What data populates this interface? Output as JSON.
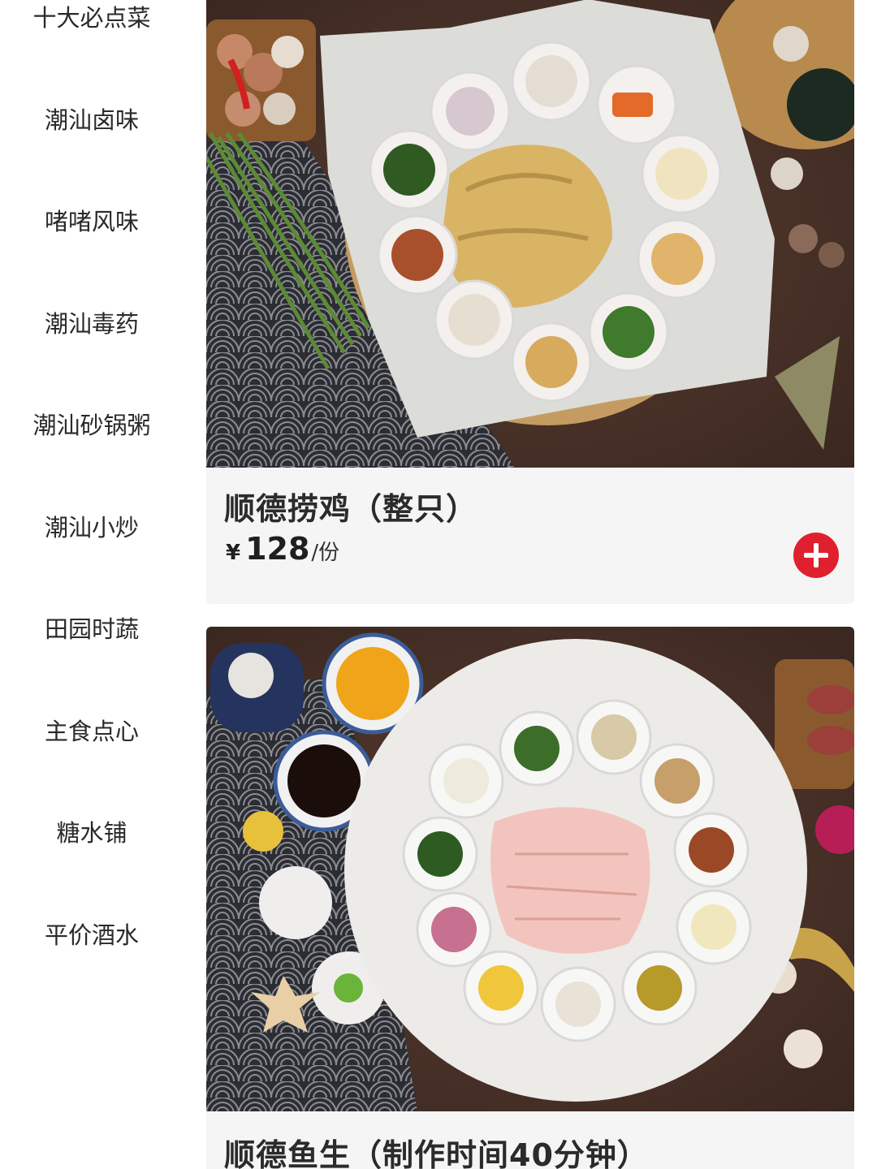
{
  "sidebar": {
    "categories": [
      {
        "label": "十大必点菜"
      },
      {
        "label": "潮汕卤味"
      },
      {
        "label": "啫啫风味"
      },
      {
        "label": "潮汕毒药"
      },
      {
        "label": "潮汕砂锅粥"
      },
      {
        "label": "潮汕小炒"
      },
      {
        "label": "田园时蔬"
      },
      {
        "label": "主食点心"
      },
      {
        "label": "糖水铺"
      },
      {
        "label": "平价酒水"
      }
    ]
  },
  "menu": {
    "items": [
      {
        "title": "顺德捞鸡（整只）",
        "currency": "¥",
        "price": "128",
        "unit": "/份",
        "image_icon": "chicken-platter-photo"
      },
      {
        "title": "顺德鱼生（制作时间40分钟）",
        "image_icon": "raw-fish-platter-photo"
      }
    ]
  },
  "colors": {
    "accent": "#e0202e",
    "card_bg": "#f5f5f5",
    "text": "#2b2b2b"
  }
}
